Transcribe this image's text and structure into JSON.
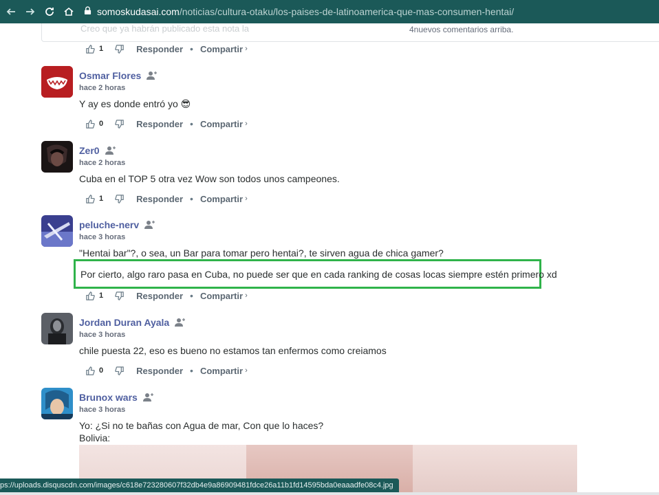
{
  "browser": {
    "domain": "somoskudasai.com",
    "path": "/noticias/cultura-otaku/los-paises-de-latinoamerica-que-mas-consumen-hentai/",
    "status_url": "ps://uploads.disquscdn.com/images/c618e723280607f32db4e9a86909481fdce26a11b1fd14595bda0eaaadfe08c4.jpg"
  },
  "prev_reply": {
    "ghost_text": "Creo que ya habrán publicado esta nota la",
    "new_comments": "4nuevos comentarios arriba."
  },
  "labels": {
    "reply": "Responder",
    "share": "Compartir",
    "sep": "•"
  },
  "top_actions": {
    "likes": "1"
  },
  "comments": [
    {
      "author": "Osmar Flores",
      "time": "hace 2 horas",
      "text": "Y ay es donde entró yo 😎",
      "likes": "0"
    },
    {
      "author": "Zer0",
      "time": "hace 2 horas",
      "text": "Cuba en el TOP 5 otra vez Wow son todos unos campeones.",
      "likes": "1"
    },
    {
      "author": "peluche-nerv",
      "time": "hace 3 horas",
      "text": "\"Hentai bar\"?, o sea, un Bar para tomar pero hentai?, te sirven agua de chica gamer?",
      "highlight": "Por cierto, algo raro pasa en Cuba, no puede ser que en cada ranking de cosas locas siempre estén primero xd",
      "likes": "1"
    },
    {
      "author": "Jordan Duran Ayala",
      "time": "hace 3 horas",
      "text": "chile puesta 22, eso es bueno no estamos tan enfermos como creiamos",
      "likes": "0"
    },
    {
      "author": "Brunox wars",
      "time": "hace 3 horas",
      "text": "Yo: ¿Si no te bañas con Agua de mar, Con que lo haces?",
      "text2": "Bolivia:"
    }
  ],
  "colors": {
    "topbar": "#1b5958",
    "author": "#4f5fa0",
    "highlight_border": "#2fb34a"
  }
}
